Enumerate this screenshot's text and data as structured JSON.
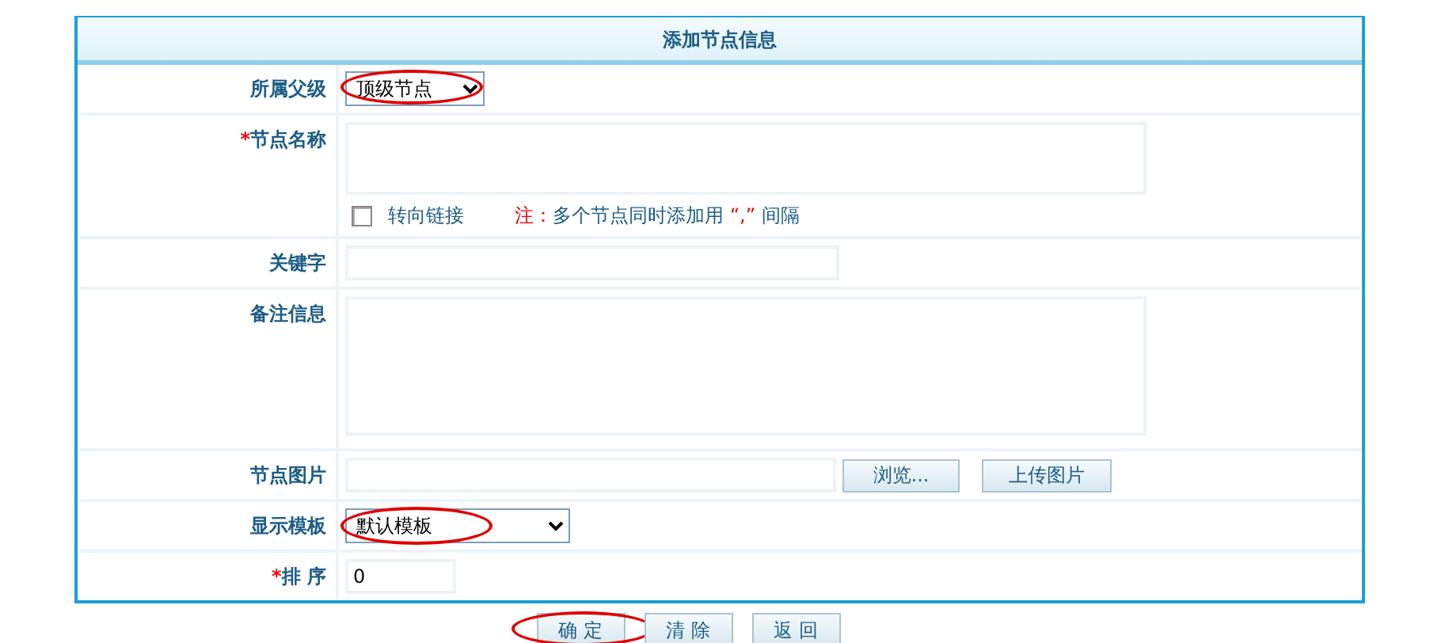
{
  "form": {
    "title": "添加节点信息",
    "fields": [
      {
        "kind": "select",
        "label": "所属父级",
        "value": "顶级节点",
        "circled": true
      },
      {
        "kind": "textarea",
        "label": "节点名称",
        "required_mark": "*",
        "checkbox": {
          "label": "转向链接",
          "checked": false
        },
        "note": [
          {
            "text": "注：",
            "emphasis": true
          },
          {
            "text": "多个节点同时添加用 ",
            "emphasis": false
          },
          {
            "text": "“,”",
            "emphasis": true
          },
          {
            "text": " 间隔",
            "emphasis": false
          }
        ]
      },
      {
        "kind": "text",
        "label": "关键字"
      },
      {
        "kind": "textarea",
        "label": "备注信息"
      },
      {
        "kind": "file",
        "label": "节点图片",
        "buttons": [
          "浏览...",
          "上传图片"
        ]
      },
      {
        "kind": "select",
        "label": "显示模板",
        "value": "默认模板",
        "circled": true
      },
      {
        "kind": "text",
        "label": "排 序",
        "required_mark": "*",
        "value": "0"
      }
    ]
  },
  "buttons": [
    {
      "label": "确 定",
      "circled": true
    },
    {
      "label": "清 除",
      "circled": false
    },
    {
      "label": "返 回",
      "circled": false
    }
  ]
}
